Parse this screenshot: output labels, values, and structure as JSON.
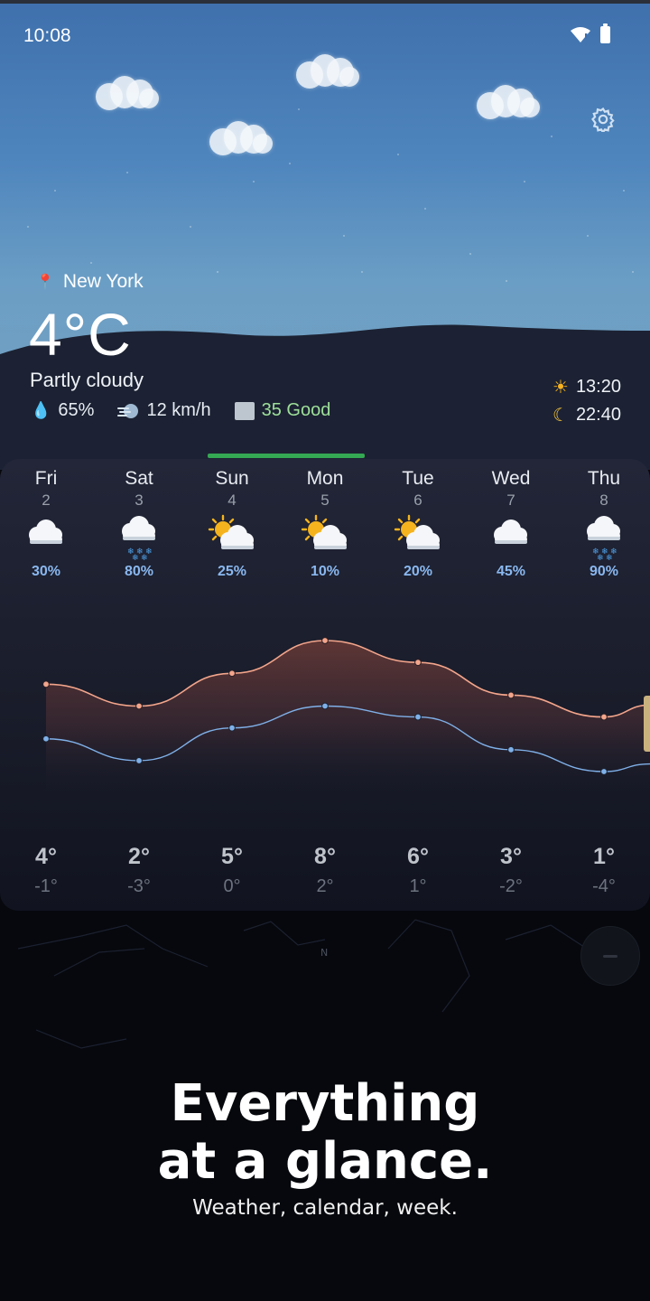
{
  "status_bar": {
    "time": "10:08"
  },
  "current": {
    "location": "New York",
    "temperature": "4°C",
    "condition": "Partly cloudy",
    "humidity": "65%",
    "wind": "12 km/h",
    "aqi": "35 Good",
    "sunrise": "13:20",
    "sunset": "22:40"
  },
  "forecast": [
    {
      "day": "Fri",
      "date": "2",
      "icon": "cloud",
      "precip": "30%",
      "high": "4°",
      "low": "-1°"
    },
    {
      "day": "Sat",
      "date": "3",
      "icon": "snow",
      "precip": "80%",
      "high": "2°",
      "low": "-3°"
    },
    {
      "day": "Sun",
      "date": "4",
      "icon": "partly-sunny",
      "precip": "25%",
      "high": "5°",
      "low": "0°"
    },
    {
      "day": "Mon",
      "date": "5",
      "icon": "partly-sunny",
      "precip": "10%",
      "high": "8°",
      "low": "2°"
    },
    {
      "day": "Tue",
      "date": "6",
      "icon": "partly-sunny",
      "precip": "20%",
      "high": "6°",
      "low": "1°"
    },
    {
      "day": "Wed",
      "date": "7",
      "icon": "cloud",
      "precip": "45%",
      "high": "3°",
      "low": "-2°"
    },
    {
      "day": "Thu",
      "date": "8",
      "icon": "snow",
      "precip": "90%",
      "high": "1°",
      "low": "-4°"
    }
  ],
  "temps": {
    "highs": [
      4,
      2,
      5,
      8,
      6,
      3,
      1
    ],
    "lows": [
      -1,
      -3,
      0,
      2,
      1,
      -2,
      -4
    ]
  },
  "compass_label": "N",
  "promo": {
    "headline_line1": "Everything",
    "headline_line2": "at a glance.",
    "subtitle": "Weather, calendar, week."
  },
  "colors": {
    "high_line": "#f3a58b",
    "low_line": "#7fb0e8",
    "accent_green": "#34a853"
  }
}
